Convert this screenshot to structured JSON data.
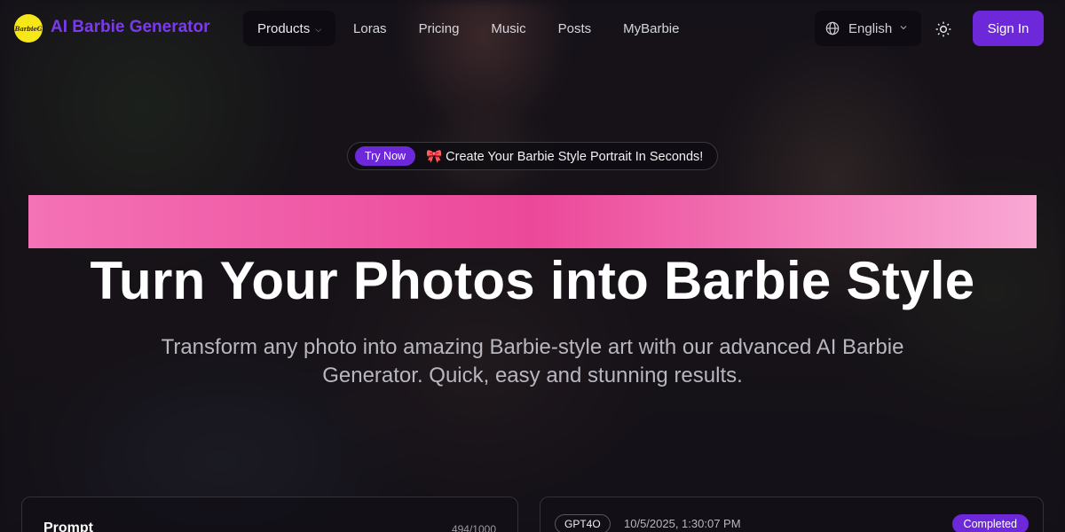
{
  "colors": {
    "accent": "#6d28d9",
    "brand_text": "#7c3aed",
    "logo_bg": "#f6e718",
    "pink_band_start": "#f472b6",
    "pink_band_mid": "#ec4899",
    "pink_band_end": "#f9a8d4"
  },
  "header": {
    "logo_text": "BarbieG",
    "brand": "AI Barbie Generator",
    "nav": [
      {
        "label": "Products",
        "has_dropdown": true,
        "active": true
      },
      {
        "label": "Loras"
      },
      {
        "label": "Pricing"
      },
      {
        "label": "Music"
      },
      {
        "label": "Posts"
      },
      {
        "label": "MyBarbie"
      }
    ],
    "language": "English",
    "icons": [
      "globe-icon",
      "chevron-down-icon",
      "sun-icon"
    ],
    "sign_in": "Sign In"
  },
  "hero": {
    "badge_button": "Try Now",
    "badge_icon": "🎀",
    "badge_text": "Create Your Barbie Style Portrait In Seconds!",
    "title": "Turn Your Photos into Barbie Style",
    "subtitle": "Transform any photo into amazing Barbie-style art with our advanced AI Barbie Generator. Quick, easy and stunning results."
  },
  "prompt_panel": {
    "label": "Prompt",
    "count": "494/1000"
  },
  "result_panel": {
    "model": "GPT4O",
    "timestamp": "10/5/2025, 1:30:07 PM",
    "status": "Completed"
  }
}
